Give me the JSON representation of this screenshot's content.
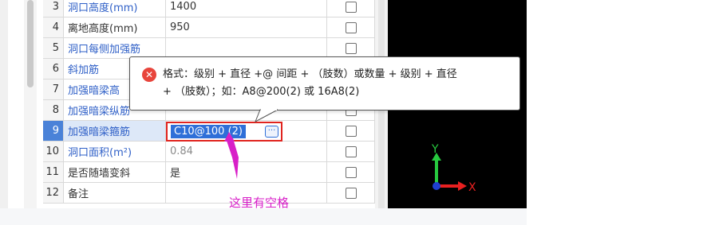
{
  "table": {
    "rows": [
      {
        "num": "3",
        "name": "洞口高度(mm)",
        "value": "1400"
      },
      {
        "num": "4",
        "name": "离地高度(mm)",
        "value": "950"
      },
      {
        "num": "5",
        "name": "洞口每侧加强筋",
        "value": ""
      },
      {
        "num": "6",
        "name": "斜加筋",
        "value": ""
      },
      {
        "num": "7",
        "name": "加强暗梁高",
        "value": ""
      },
      {
        "num": "8",
        "name": "加强暗梁纵筋",
        "value": ""
      },
      {
        "num": "9",
        "name": "加强暗梁箍筋",
        "value": ""
      },
      {
        "num": "10",
        "name": "洞口面积(m²)",
        "value": "0.84"
      },
      {
        "num": "11",
        "name": "是否随墙变斜",
        "value": "是"
      },
      {
        "num": "12",
        "name": "备注",
        "value": ""
      }
    ]
  },
  "editor": {
    "value": "C10@100 (2)",
    "button_label": "···"
  },
  "tooltip": {
    "icon": "error-icon",
    "line1": "格式：级别 + 直径 +@ 间距 + （肢数）或数量 + 级别 + 直径",
    "line2": "+ （肢数）；如：A8@200(2) 或 16A8(2)"
  },
  "annotation": {
    "text": "这里有空格",
    "color": "#d81fc8"
  },
  "viewport": {
    "axis_y_label": "Y",
    "axis_x_label": "X"
  },
  "colors": {
    "link": "#2e5fc7",
    "selected_row": "#4a82d8",
    "error": "#e0241f",
    "axis_y": "#27c93f",
    "axis_x": "#e82020"
  }
}
